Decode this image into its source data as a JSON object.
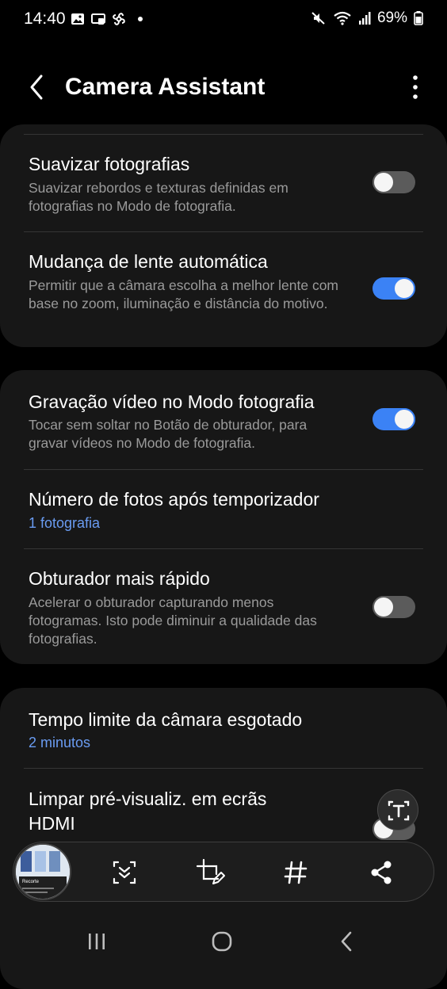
{
  "status_bar": {
    "time": "14:40",
    "battery": "69%",
    "icons_left": [
      "gallery-icon",
      "screen-cast-icon",
      "pinwheel-icon",
      "notification-dot"
    ],
    "icons_right": [
      "mute-icon",
      "wifi-icon",
      "signal-icon",
      "battery-icon"
    ]
  },
  "app_bar": {
    "title": "Camera Assistant"
  },
  "sections": [
    {
      "rows": [
        {
          "title": "Suavizar fotografias",
          "description": "Suavizar rebordos e texturas definidas em fotografias no Modo de fotografia.",
          "toggle": false
        },
        {
          "title": "Mudança de lente automática",
          "description": "Permitir que a câmara escolha a melhor lente com base no zoom, iluminação e distância do motivo.",
          "toggle": true
        }
      ]
    },
    {
      "rows": [
        {
          "title": "Gravação vídeo no Modo fotografia",
          "description": "Tocar sem soltar no Botão de obturador, para gravar vídeos no Modo de fotografia.",
          "toggle": true
        },
        {
          "title": "Número de fotos após temporizador",
          "value": "1 fotografia"
        },
        {
          "title": "Obturador mais rápido",
          "description": "Acelerar o obturador capturando menos fotogramas. Isto pode diminuir a qualidade das fotografias.",
          "toggle": false
        }
      ]
    },
    {
      "rows": [
        {
          "title": "Tempo limite da câmara esgotado",
          "value": "2 minutos"
        },
        {
          "title_line1": "Limpar pré-visualiz. em ecrãs",
          "title_line2": "HDMI",
          "toggle": false
        }
      ]
    }
  ],
  "screenshot_toolbar": {
    "thumbnail_label": "Recorte",
    "buttons": [
      "scroll-capture-icon",
      "crop-edit-icon",
      "hashtag-icon",
      "share-icon"
    ],
    "floating_button": "text-extract-icon"
  },
  "nav_bar": {
    "buttons": [
      "recents-icon",
      "home-icon",
      "back-icon"
    ]
  },
  "colors": {
    "background": "#000000",
    "card": "#171717",
    "accent": "#3b82f5",
    "value_text": "#6a9cf2",
    "secondary_text": "#9a9a9a"
  }
}
